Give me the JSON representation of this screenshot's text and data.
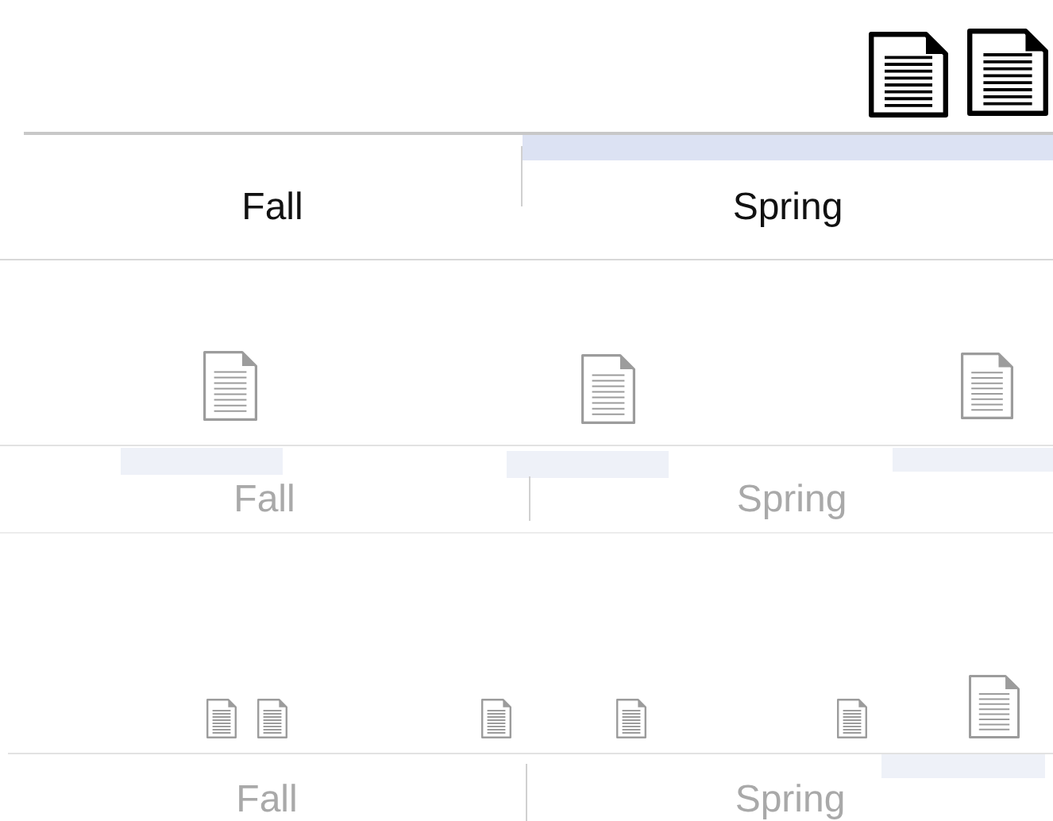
{
  "panels": [
    {
      "kind": "active",
      "tabs": [
        {
          "label": "Fall",
          "selected": false
        },
        {
          "label": "Spring",
          "selected": true
        }
      ]
    },
    {
      "kind": "faded",
      "tabs": [
        {
          "label": "Fall",
          "selected": false
        },
        {
          "label": "Spring",
          "selected": false
        }
      ]
    },
    {
      "kind": "faded",
      "tabs": [
        {
          "label": "Fall",
          "selected": false
        },
        {
          "label": "Spring",
          "selected": false
        }
      ]
    }
  ]
}
